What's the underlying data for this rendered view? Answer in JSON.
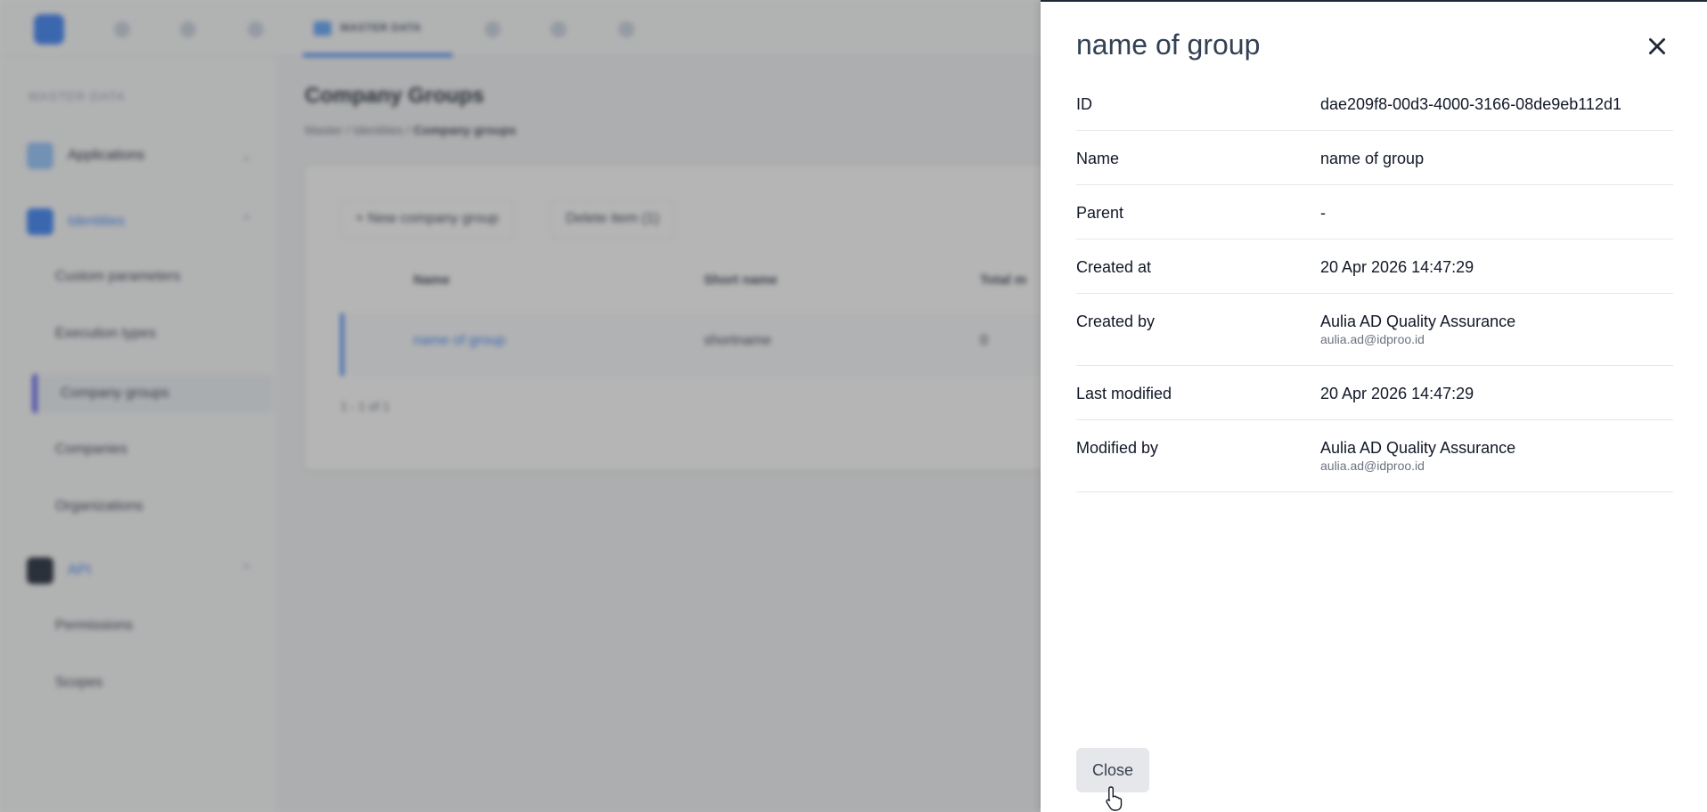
{
  "background": {
    "nav_active_tab": "MASTER DATA",
    "sidebar": {
      "section_title": "MASTER DATA",
      "groups": [
        {
          "label": "Applications",
          "items": []
        },
        {
          "label": "Identities",
          "items": [
            "Custom parameters",
            "Execution types",
            "Company groups",
            "Companies",
            "Organizations"
          ]
        },
        {
          "label": "API",
          "items": [
            "Permissions",
            "Scopes"
          ]
        }
      ]
    },
    "page_title": "Company Groups",
    "breadcrumb": [
      "Master",
      "Identities",
      "Company groups"
    ],
    "buttons": {
      "new": "+ New company group",
      "delete": "Delete item (1)"
    },
    "table": {
      "headers": [
        "Name",
        "Short name",
        "Total m"
      ],
      "rows": [
        {
          "name": "name of group",
          "short_name": "shortname",
          "total": "0"
        }
      ]
    },
    "pagination": "1 - 1 of 1"
  },
  "drawer": {
    "title": "name of group",
    "fields": [
      {
        "label": "ID",
        "value": "dae209f8-00d3-4000-3166-08de9eb112d1"
      },
      {
        "label": "Name",
        "value": "name of group"
      },
      {
        "label": "Parent",
        "value": "-"
      },
      {
        "label": "Created at",
        "value": "20 Apr 2026 14:47:29"
      },
      {
        "label": "Created by",
        "value": "Aulia AD Quality Assurance",
        "sub": "aulia.ad@idproo.id"
      },
      {
        "label": "Last modified",
        "value": "20 Apr 2026 14:47:29"
      },
      {
        "label": "Modified by",
        "value": "Aulia AD Quality Assurance",
        "sub": "aulia.ad@idproo.id"
      }
    ],
    "close_button": "Close"
  }
}
